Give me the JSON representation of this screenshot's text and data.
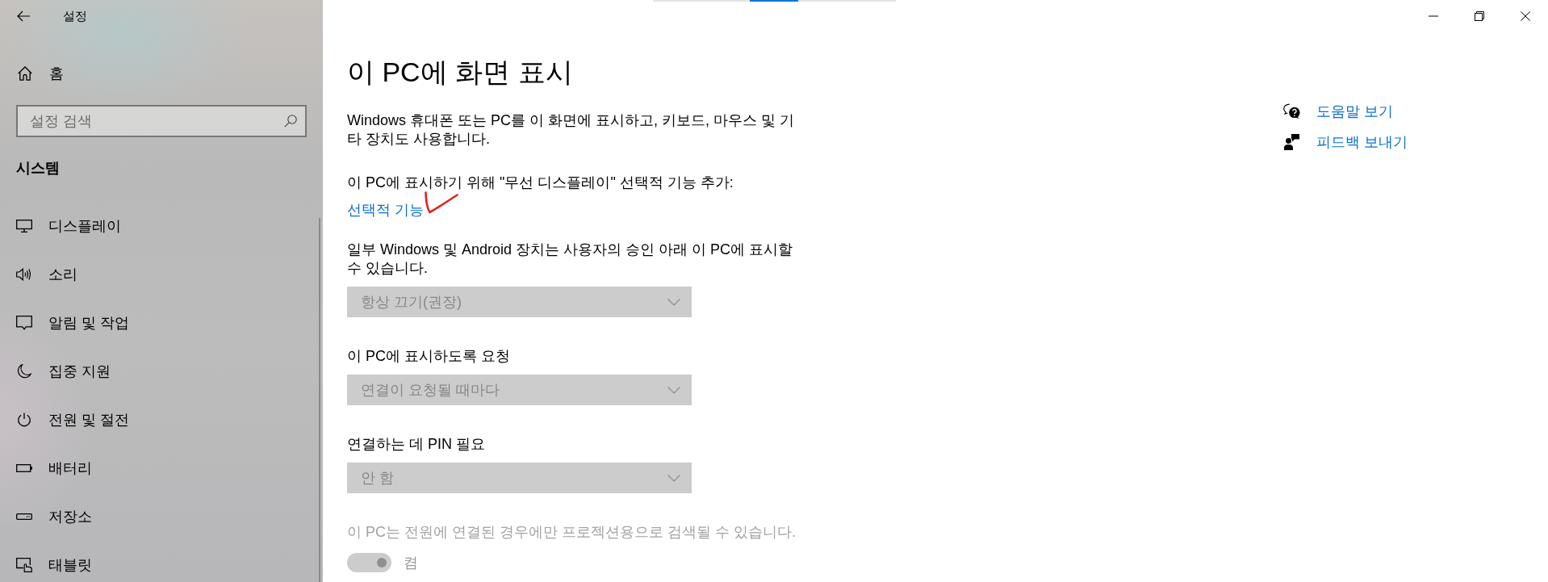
{
  "window": {
    "title": "설정",
    "loading": true
  },
  "sidebar": {
    "home": "홈",
    "search": {
      "placeholder": "설정 검색"
    },
    "section": "시스템",
    "items": [
      {
        "label": "디스플레이",
        "selected": false
      },
      {
        "label": "소리",
        "selected": false
      },
      {
        "label": "알림 및 작업",
        "selected": false
      },
      {
        "label": "집중 지원",
        "selected": false
      },
      {
        "label": "전원 및 절전",
        "selected": false
      },
      {
        "label": "배터리",
        "selected": false
      },
      {
        "label": "저장소",
        "selected": false
      },
      {
        "label": "태블릿",
        "selected": false
      }
    ]
  },
  "page": {
    "title": "이 PC에 화면 표시",
    "description": "Windows 휴대폰 또는 PC를 이 화면에 표시하고, 키보드, 마우스 및 기타 장치도 사용합니다.",
    "feature_prompt": "이 PC에 표시하기 위해 \"무선 디스플레이\" 선택적 기능 추가:",
    "feature_link": {
      "text": "선택적 기능",
      "marked": true
    },
    "settings": [
      {
        "kind": "dropdown",
        "label": "일부 Windows 및 Android 장치는 사용자의 승인 아래 이 PC에 표시할 수 있습니다.",
        "value": "항상 끄기(권장)",
        "disabled": true
      },
      {
        "kind": "dropdown",
        "label": "이 PC에 표시하도록 요청",
        "value": "연결이 요청될 때마다",
        "disabled": true
      },
      {
        "kind": "dropdown",
        "label": "연결하는 데 PIN 필요",
        "value": "안 함",
        "disabled": true
      },
      {
        "kind": "toggle",
        "label": "이 PC는 전원에 연결된 경우에만 프로젝션용으로 검색될 수 있습니다.",
        "state_text": "켬",
        "on": true,
        "disabled": true
      }
    ]
  },
  "related": [
    {
      "label": "도움말 보기"
    },
    {
      "label": "피드백 보내기"
    }
  ]
}
